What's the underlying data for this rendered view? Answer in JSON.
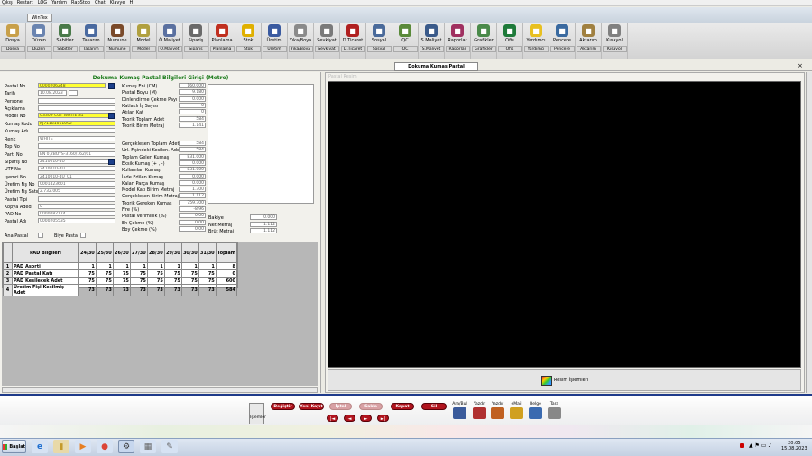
{
  "menu": [
    "Çıkış",
    "Restart",
    "LOG",
    "Yardım",
    "RapStop",
    "Chat",
    "Klavye",
    "H"
  ],
  "window_tab": "WinTex",
  "ribbon": [
    {
      "label": "Dosya",
      "sub": "Dosya",
      "icon": "folder-icon",
      "color": "#c8a04a"
    },
    {
      "label": "Düzen",
      "sub": "Düzen",
      "icon": "edit-icon",
      "color": "#6a84b0"
    },
    {
      "label": "Sabitler",
      "sub": "Sabitler",
      "icon": "pin-icon",
      "color": "#4a7a4a"
    },
    {
      "label": "Tasarım",
      "sub": "Tasarım",
      "icon": "design-icon",
      "color": "#4a6aa0"
    },
    {
      "label": "Numune",
      "sub": "Numune",
      "icon": "sample-icon",
      "color": "#7a4a2a"
    },
    {
      "label": "Model",
      "sub": "Model",
      "icon": "model-icon",
      "color": "#b0a040"
    },
    {
      "label": "Ö.Maliyet",
      "sub": "Ö.Maliyet",
      "icon": "cost-icon",
      "color": "#5a70a0"
    },
    {
      "label": "Sipariş",
      "sub": "Sipariş",
      "icon": "order-icon",
      "color": "#6a6a6a"
    },
    {
      "label": "Planlama",
      "sub": "Planlama",
      "icon": "planning-icon",
      "color": "#c03020"
    },
    {
      "label": "Stok",
      "sub": "Stok",
      "icon": "star-icon",
      "color": "#e0b000"
    },
    {
      "label": "Üretim",
      "sub": "Üretim",
      "icon": "production-icon",
      "color": "#3a5aa0"
    },
    {
      "label": "Yıka/Boya",
      "sub": "Yıka/Boya",
      "icon": "wash-icon",
      "color": "#8a8a8a"
    },
    {
      "label": "Sevkiyat",
      "sub": "Sevkiyat",
      "icon": "shipping-icon",
      "color": "#7a7a7a"
    },
    {
      "label": "D.Ticaret",
      "sub": "D.Ticaret",
      "icon": "trade-icon",
      "color": "#b02020"
    },
    {
      "label": "Sosyal",
      "sub": "Sosyal",
      "icon": "social-icon",
      "color": "#4a6a9a"
    },
    {
      "label": "QC",
      "sub": "QC",
      "icon": "qc-icon",
      "color": "#5a8a3a"
    },
    {
      "label": "S.Maliyet",
      "sub": "S.Maliyet",
      "icon": "cost2-icon",
      "color": "#3a5a8a"
    },
    {
      "label": "Raporlar",
      "sub": "Raporlar",
      "icon": "reports-icon",
      "color": "#a03060"
    },
    {
      "label": "Grafikler",
      "sub": "Grafikler",
      "icon": "chart-icon",
      "color": "#4a8a4a"
    },
    {
      "label": "Ofis",
      "sub": "Ofis",
      "icon": "excel-icon",
      "color": "#1e7a3a"
    },
    {
      "label": "Yardımcı",
      "sub": "Yardımcı",
      "icon": "smiley-icon",
      "color": "#e8c020"
    },
    {
      "label": "Pencere",
      "sub": "Pencere",
      "icon": "window-icon",
      "color": "#3a6aa0"
    },
    {
      "label": "Aktarım",
      "sub": "Aktarım",
      "icon": "transfer-icon",
      "color": "#a08040"
    },
    {
      "label": "Kısayol",
      "sub": "Kısayol",
      "icon": "wrench-icon",
      "color": "#808080"
    }
  ],
  "doc_tab": "Dokuma Kumaş Pastal Çalışması",
  "form_title": "Dokuma Kumaş Pastal Bilgileri Girişi (Metre)",
  "left_fields": [
    {
      "label": "Pastal No",
      "value": "0000206248",
      "yellow": true
    },
    {
      "label": "Tarih",
      "value": "10.08.2023",
      "yellow": false
    },
    {
      "label": "Personel",
      "value": "",
      "yellow": false
    },
    {
      "label": "Açıklama",
      "value": "",
      "yellow": false
    },
    {
      "label": "Model No",
      "value": "C3309 CUT WHITE S1",
      "yellow": true
    },
    {
      "label": "Kumaş Kodu",
      "value": "KJ71181011092",
      "yellow": true
    },
    {
      "label": "Kumaş Adı",
      "value": "",
      "yellow": false
    },
    {
      "label": "Renk",
      "value": "WHITE",
      "yellow": false
    },
    {
      "label": "Top No",
      "value": "",
      "yellow": false
    },
    {
      "label": "Parti No",
      "value": "EN 0,2BOYS-3160/162/01",
      "yellow": false
    },
    {
      "label": "Sipariş No",
      "value": "2410010-4U",
      "yellow": false
    },
    {
      "label": "UTF No",
      "value": "2410010-4U",
      "yellow": false
    },
    {
      "label": "İşemri No",
      "value": "2410010-4U_01",
      "yellow": false
    },
    {
      "label": "Üretim Fiş No",
      "value": "0001423601",
      "yellow": false
    },
    {
      "label": "Üretim Fiş Satır",
      "value": "2.732.005",
      "yellow": false
    },
    {
      "label": "Pastal Tipi",
      "value": "",
      "yellow": false
    },
    {
      "label": "Kopya Adedi",
      "value": "0",
      "yellow": false
    },
    {
      "label": "PAD No",
      "value": "0000082174",
      "yellow": false
    },
    {
      "label": "Pastal Adı",
      "value": "0000205535",
      "yellow": false
    }
  ],
  "ana_pastal_label": "Ana Pastal",
  "biye_pastal_label": "Biye Pastal",
  "mid_fields": [
    {
      "label": "Kumaş Eni (CM)",
      "value": "160.000"
    },
    {
      "label": "Pastal Boyu (M)",
      "value": "9.180"
    },
    {
      "label": "Dinlendirme Çekme Payı (M)",
      "value": "0.000"
    },
    {
      "label": "Katlaklı İş Sayısı",
      "value": "0"
    },
    {
      "label": "Atılan Kat",
      "value": "0"
    },
    {
      "label": "Teorik Toplam Adet",
      "value": "584"
    },
    {
      "label": "Teorik Birim Metraj",
      "value": "1.141"
    }
  ],
  "mid_fields2": [
    {
      "label": "Gerçekleşen Toplam Adet",
      "value": "584"
    },
    {
      "label": "Url. Fişindeki Kesilen. Adet",
      "value": "584"
    },
    {
      "label": "Toplam Gelen Kumaş",
      "value": "831.000"
    },
    {
      "label": "Eksik Kumaş (+ , -)",
      "value": "0.000"
    },
    {
      "label": "Kullanılan Kumaş",
      "value": "831.000"
    },
    {
      "label": "İade Edilen Kumaş",
      "value": "0.000"
    },
    {
      "label": "Kalan Parça Kumaş",
      "value": "0.000"
    },
    {
      "label": "Model Katı Birim Metraj",
      "value": "1.300"
    },
    {
      "label": "Gerçekleşen Birim Metraj",
      "value": "1.112"
    },
    {
      "label": "Teorik Gereken Kumaş",
      "value": "759.300"
    },
    {
      "label": "Fire (%)",
      "value": "-8.96"
    },
    {
      "label": "Pastal Verimlilik (%)",
      "value": "0.00"
    },
    {
      "label": "En Çekme (%)",
      "value": "0.00"
    },
    {
      "label": "Boy Çekme (%)",
      "value": "0.00"
    }
  ],
  "right_fields": [
    {
      "label": "Bakiye",
      "value": "0.000"
    },
    {
      "label": "Net Metraj",
      "value": "1.112"
    },
    {
      "label": "Brüt Metraj",
      "value": "1.112"
    }
  ],
  "grid": {
    "header_label": "PAD Bilgileri",
    "columns": [
      "24/30",
      "25/30",
      "26/30",
      "27/30",
      "28/30",
      "29/30",
      "30/30",
      "31/30",
      "Toplam"
    ],
    "rows": [
      {
        "n": "1",
        "label": "PAD Asorti",
        "values": [
          "1",
          "1",
          "1",
          "1",
          "1",
          "1",
          "1",
          "1",
          "8"
        ]
      },
      {
        "n": "2",
        "label": "PAD Pastal Katı",
        "values": [
          "75",
          "75",
          "75",
          "75",
          "75",
          "75",
          "75",
          "75",
          "0"
        ]
      },
      {
        "n": "3",
        "label": "PAD Kesilecek Adet",
        "values": [
          "75",
          "75",
          "75",
          "75",
          "75",
          "75",
          "75",
          "75",
          "600"
        ]
      },
      {
        "n": "4",
        "label": "Üretim Fişi Kesilmiş Adet",
        "values": [
          "73",
          "73",
          "73",
          "73",
          "73",
          "73",
          "73",
          "73",
          "584"
        ]
      }
    ]
  },
  "image_panel_label": "Pastal Resim",
  "image_button": "Resim İşlemleri",
  "bottom": {
    "islemler": "İşlemler",
    "buttons": [
      "Değiştir",
      "Yeni Kayıt",
      "İptal",
      "Sakla",
      "Kapat",
      "Sil"
    ],
    "nav": [
      "|◄",
      "◄",
      "►",
      "►|"
    ],
    "tools": [
      "Ara/Bul",
      "Yazdır",
      "Yazdır",
      "eMail",
      "Belge",
      "Tara"
    ]
  },
  "taskbar": {
    "start": "Başlat",
    "time": "20:05",
    "date": "15.08.2023"
  }
}
